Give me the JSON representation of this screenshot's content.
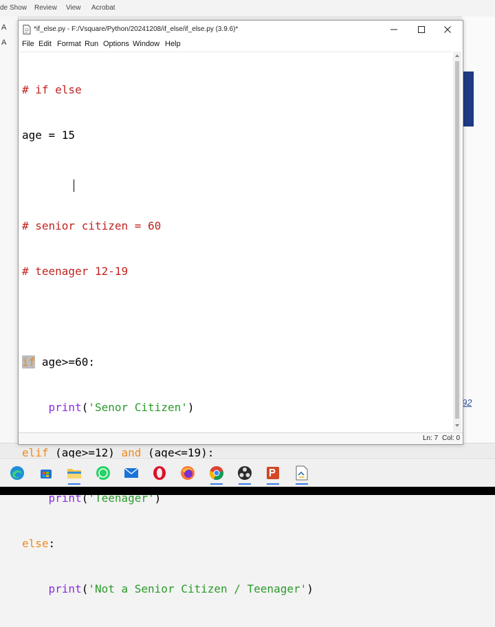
{
  "background": {
    "ribbon_items": [
      "de Show",
      "Review",
      "View",
      "Acrobat"
    ],
    "left_strip": [
      "A",
      "A"
    ],
    "page_number": "92"
  },
  "window": {
    "title": "*if_else.py - F:/Vsquare/Python/20241208/if_else/if_else.py (3.9.6)*",
    "menu": [
      "File",
      "Edit",
      "Format",
      "Run",
      "Options",
      "Window",
      "Help"
    ]
  },
  "editor": {
    "lines": [
      "# if else",
      "age = 15",
      "",
      "# senior citizen = 60",
      "# teenager 12-19",
      "",
      "if age>=60:",
      "    print('Senor Citizen')",
      "elif (age>=12) and (age<=19):",
      "    print('Teenager')",
      "else:",
      "    print('Not a Senior Citizen / Teenager')"
    ],
    "tokens": {
      "l0": "# if else",
      "l1": "age = 15",
      "l3": "# senior citizen = 60",
      "l4": "# teenager 12-19",
      "l6_kw": "if",
      "l6_rest": " age>=60:",
      "l7_indent": "    ",
      "l7_fn": "print",
      "l7_open": "(",
      "l7_str": "'Senor Citizen'",
      "l7_close": ")",
      "l8_kw1": "elif",
      "l8_mid": " (age>=12) ",
      "l8_kw2": "and",
      "l8_rest": " (age<=19):",
      "l9_indent": "    ",
      "l9_fn": "print",
      "l9_open": "(",
      "l9_str": "'Teenager'",
      "l9_close": ")",
      "l10_kw": "else",
      "l10_rest": ":",
      "l11_indent": "    ",
      "l11_fn": "print",
      "l11_open": "(",
      "l11_str": "'Not a Senior Citizen / Teenager'",
      "l11_close": ")"
    }
  },
  "status": {
    "line": "Ln: 7",
    "col": "Col: 0"
  },
  "colors": {
    "comment": "#c2231f",
    "keyword": "#f08a1a",
    "builtin": "#8a2be2",
    "string": "#2a9a2a",
    "selection": "#bcbcbc"
  },
  "taskbar": {
    "icons": [
      "edge-icon",
      "store-icon",
      "file-explorer-icon",
      "whatsapp-icon",
      "mail-icon",
      "opera-icon",
      "firefox-icon",
      "chrome-icon",
      "obs-icon",
      "powerpoint-icon",
      "idle-icon"
    ]
  }
}
